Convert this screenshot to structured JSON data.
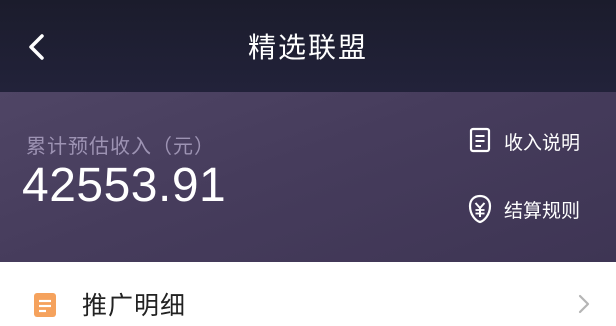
{
  "nav": {
    "title": "精选联盟",
    "back_icon": "chevron-left-icon"
  },
  "earnings": {
    "label": "累计预估收入（元）",
    "value": "42553.91"
  },
  "links": {
    "income_explain": {
      "label": "收入说明",
      "icon": "document-icon"
    },
    "settlement_rules": {
      "label": "结算规则",
      "icon": "yuan-shield-icon"
    }
  },
  "detail_row": {
    "label": "推广明细",
    "icon": "list-doc-icon",
    "arrow_icon": "chevron-right-icon"
  },
  "colors": {
    "nav_bg": "#1b1c2c",
    "card_bg": "#463c5c",
    "label_muted": "#9d93b3",
    "accent_orange": "#f5a25d"
  }
}
